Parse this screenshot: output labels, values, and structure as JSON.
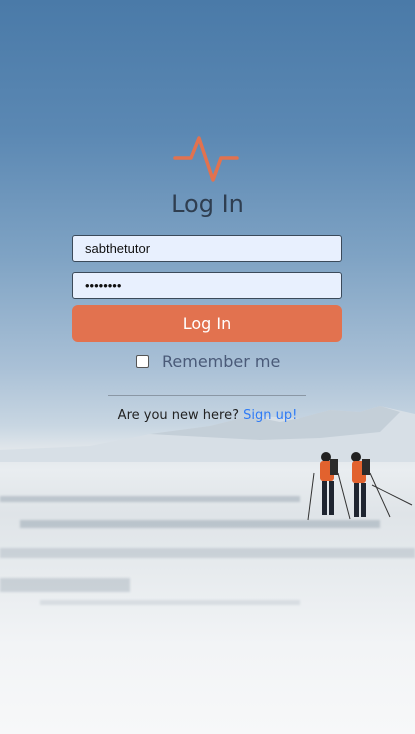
{
  "brand": {
    "accent_color": "#e2724f",
    "logo_icon": "heartbeat-pulse-icon"
  },
  "login": {
    "title": "Log In",
    "username_value": "sabthetutor",
    "password_value": "••••••••",
    "submit_label": "Log In",
    "remember_label": "Remember me",
    "remember_checked": false
  },
  "signup": {
    "prompt": "Are you new here?",
    "link_label": "Sign up!",
    "link_color": "#2f7bf5"
  },
  "background": {
    "description_icon": "frozen-lake-photo"
  }
}
